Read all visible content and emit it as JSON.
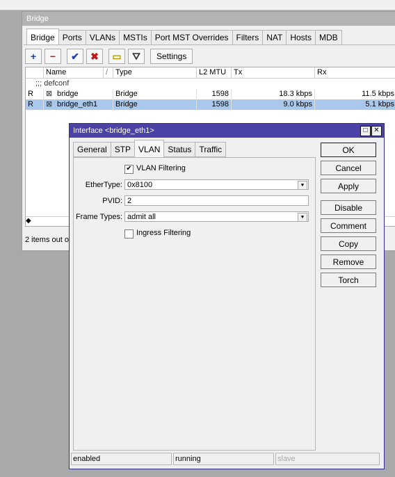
{
  "bridge_window": {
    "title": "Bridge",
    "tabs": [
      "Bridge",
      "Ports",
      "VLANs",
      "MSTIs",
      "Port MST Overrides",
      "Filters",
      "NAT",
      "Hosts",
      "MDB"
    ],
    "toolbar": {
      "add_symbol": "+",
      "remove_symbol": "−",
      "enable_symbol": "✔",
      "disable_symbol": "✖",
      "comment_symbol": "▭",
      "filter_symbol": "⛛",
      "settings_label": "Settings"
    },
    "columns": [
      "Name",
      "/",
      "Type",
      "L2 MTU",
      "Tx",
      "Rx"
    ],
    "group_label": ";;; defconf",
    "rows": [
      {
        "flag": "R",
        "name": "bridge",
        "type": "Bridge",
        "l2mtu": "1598",
        "tx": "18.3 kbps",
        "rx": "11.5 kbps"
      },
      {
        "flag": "R",
        "name": "bridge_eth1",
        "type": "Bridge",
        "l2mtu": "1598",
        "tx": "9.0 kbps",
        "rx": "5.1 kbps"
      }
    ],
    "scroll_left": "◆",
    "status": "2 items out o"
  },
  "interface_dialog": {
    "title": "Interface <bridge_eth1>",
    "restore_symbol": "□",
    "close_symbol": "✕",
    "tabs": [
      "General",
      "STP",
      "VLAN",
      "Status",
      "Traffic"
    ],
    "vlan_filtering_label": "VLAN Filtering",
    "vlan_filtering_mark": "✔",
    "ethertype_label": "EtherType:",
    "ethertype_value": "0x8100",
    "pvid_label": "PVID:",
    "pvid_value": "2",
    "frame_types_label": "Frame Types:",
    "frame_types_value": "admit all",
    "ingress_filtering_label": "Ingress Filtering",
    "dropdown_symbol": "⯆",
    "buttons": [
      "OK",
      "Cancel",
      "Apply",
      "Disable",
      "Comment",
      "Copy",
      "Remove",
      "Torch"
    ],
    "status": [
      "enabled",
      "running",
      "slave"
    ]
  }
}
